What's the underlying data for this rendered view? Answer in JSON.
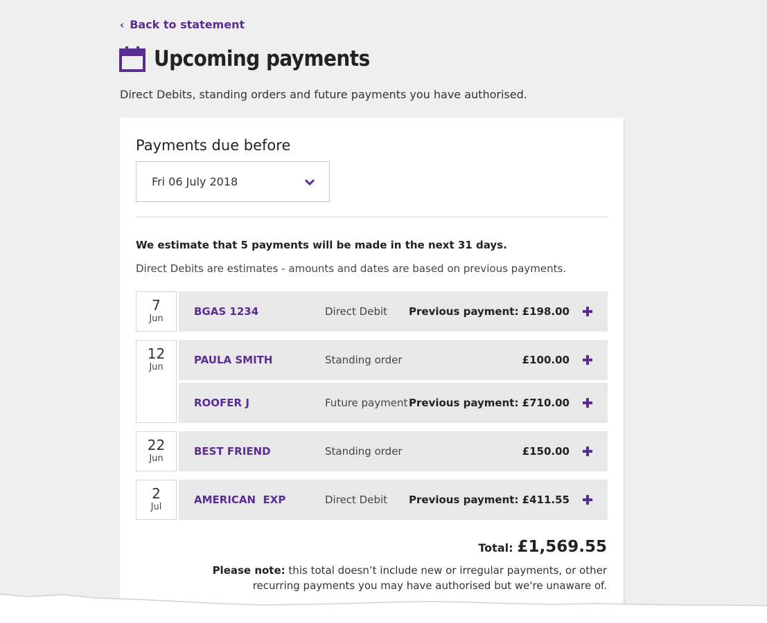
{
  "nav": {
    "back_label": "Back to statement"
  },
  "header": {
    "title": "Upcoming payments",
    "subtitle": "Direct Debits, standing orders and future payments you have authorised."
  },
  "filter": {
    "label": "Payments due before",
    "selected_date": "Fri 06 July 2018"
  },
  "summary": {
    "estimate": "We estimate that 5 payments will be made in the next 31 days.",
    "dd_note": "Direct Debits are estimates - amounts and dates are based on previous payments."
  },
  "groups": [
    {
      "day": "7",
      "month": "Jun",
      "payments": [
        {
          "payee": "BGAS 1234",
          "type": "Direct Debit",
          "amount": "Previous payment: £198.00"
        }
      ]
    },
    {
      "day": "12",
      "month": "Jun",
      "payments": [
        {
          "payee": "PAULA SMITH",
          "type": "Standing order",
          "amount": "£100.00"
        },
        {
          "payee": "ROOFER J",
          "type": "Future payment",
          "amount": "Previous payment: £710.00"
        }
      ]
    },
    {
      "day": "22",
      "month": "Jun",
      "payments": [
        {
          "payee": "BEST FRIEND",
          "type": "Standing order",
          "amount": "£150.00"
        }
      ]
    },
    {
      "day": "2",
      "month": "Jul",
      "payments": [
        {
          "payee": "AMERICAN  EXP",
          "type": "Direct Debit",
          "amount": "Previous payment: £411.55"
        }
      ]
    }
  ],
  "total": {
    "label": "Total:",
    "amount": "£1,569.55"
  },
  "footnote": {
    "bold": "Please note:",
    "text": " this total doesn’t include new or irregular payments, or other recurring payments you may have authorised but we're unaware of."
  },
  "icons": {
    "back": "chevron-left-icon",
    "title": "calendar-icon",
    "select": "chevron-down-icon",
    "expand": "plus-icon"
  },
  "colors": {
    "accent": "#5a2d91",
    "row_bg": "#e8e8e8",
    "page_bg": "#efefef"
  }
}
